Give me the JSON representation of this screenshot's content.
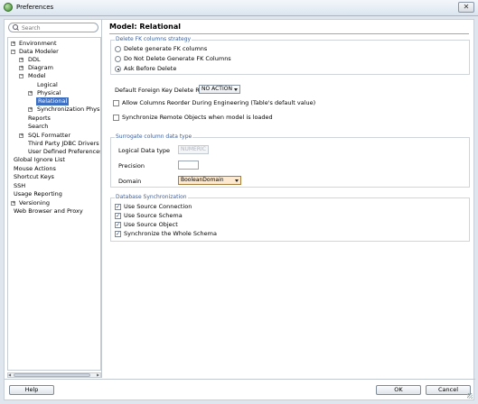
{
  "window": {
    "title": "Preferences",
    "close_glyph": "✕"
  },
  "search": {
    "placeholder": "Search"
  },
  "tree": {
    "items": [
      {
        "label": "Environment",
        "toggle": "+"
      },
      {
        "label": "Data Modeler",
        "toggle": "−"
      },
      {
        "label": "DDL",
        "toggle": "+"
      },
      {
        "label": "Diagram",
        "toggle": "+"
      },
      {
        "label": "Model",
        "toggle": "−"
      },
      {
        "label": "Logical",
        "toggle": ""
      },
      {
        "label": "Physical",
        "toggle": "+"
      },
      {
        "label": "Relational",
        "toggle": ""
      },
      {
        "label": "Synchronization Physi",
        "toggle": "+"
      },
      {
        "label": "Reports",
        "toggle": ""
      },
      {
        "label": "Search",
        "toggle": ""
      },
      {
        "label": "SQL Formatter",
        "toggle": "+"
      },
      {
        "label": "Third Party JDBC Drivers",
        "toggle": ""
      },
      {
        "label": "User Defined Preferences",
        "toggle": ""
      },
      {
        "label": "Global Ignore List",
        "toggle": ""
      },
      {
        "label": "Mouse Actions",
        "toggle": ""
      },
      {
        "label": "Shortcut Keys",
        "toggle": ""
      },
      {
        "label": "SSH",
        "toggle": ""
      },
      {
        "label": "Usage Reporting",
        "toggle": ""
      },
      {
        "label": "Versioning",
        "toggle": "+"
      },
      {
        "label": "Web Browser and Proxy",
        "toggle": ""
      }
    ],
    "selected": "Relational"
  },
  "main": {
    "title": "Model: Relational",
    "fk_strategy": {
      "title": "Delete FK columns strategy",
      "options": [
        {
          "label": "Delete generate FK columns",
          "selected": false
        },
        {
          "label": "Do Not Delete Generate FK Columns",
          "selected": false
        },
        {
          "label": "Ask Before Delete",
          "selected": true
        }
      ]
    },
    "fk_delete_rule": {
      "label": "Default Foreign Key Delete Rule:",
      "value": "NO ACTION"
    },
    "allow_reorder": {
      "label": "Allow Columns Reorder During Engineering (Table's default value)",
      "checked": false
    },
    "sync_remote": {
      "label": "Synchronize Remote Objects when model is loaded",
      "checked": false
    },
    "surrogate": {
      "title": "Surrogate column data type",
      "logical_type_label": "Logical Data type",
      "logical_type_value": "NUMERIC",
      "precision_label": "Precision",
      "precision_value": "",
      "domain_label": "Domain",
      "domain_value": "BooleanDomain"
    },
    "db_sync": {
      "title": "Database Synchronization",
      "options": [
        {
          "label": "Use Source Connection",
          "checked": true
        },
        {
          "label": "Use Source Schema",
          "checked": true
        },
        {
          "label": "Use Source Object",
          "checked": true
        },
        {
          "label": "Synchronize the Whole Schema",
          "checked": true
        }
      ]
    }
  },
  "footer": {
    "help": "Help",
    "ok": "OK",
    "cancel": "Cancel"
  },
  "colors": {
    "selection": "#3d6fc2",
    "group_title": "#3c5f99",
    "domain_bg": "#fde9cf"
  }
}
